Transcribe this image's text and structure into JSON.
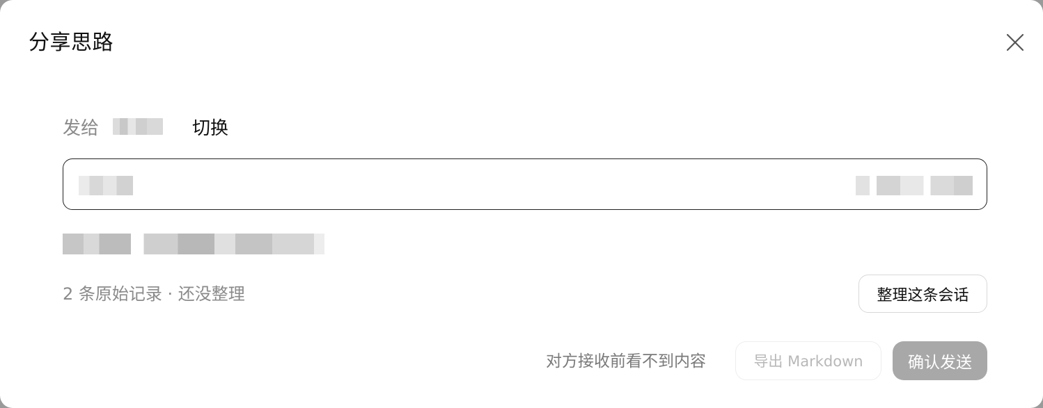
{
  "dialog": {
    "title": "分享思路",
    "close_icon": "close-icon"
  },
  "recipient": {
    "label": "发给",
    "name": "",
    "switch_label": "切换"
  },
  "session": {
    "name": "",
    "time": ""
  },
  "summary": "",
  "status": {
    "text": "2 条原始记录 · 还没整理",
    "organize_label": "整理这条会话"
  },
  "footer": {
    "notice": "对方接收前看不到内容",
    "export_label": "导出 Markdown",
    "confirm_label": "确认发送"
  },
  "colors": {
    "overlay": "#9a9a9a",
    "confirm_disabled_bg": "#a8a8a8",
    "muted_text": "#8a8a8a",
    "border_dark": "#222222"
  }
}
